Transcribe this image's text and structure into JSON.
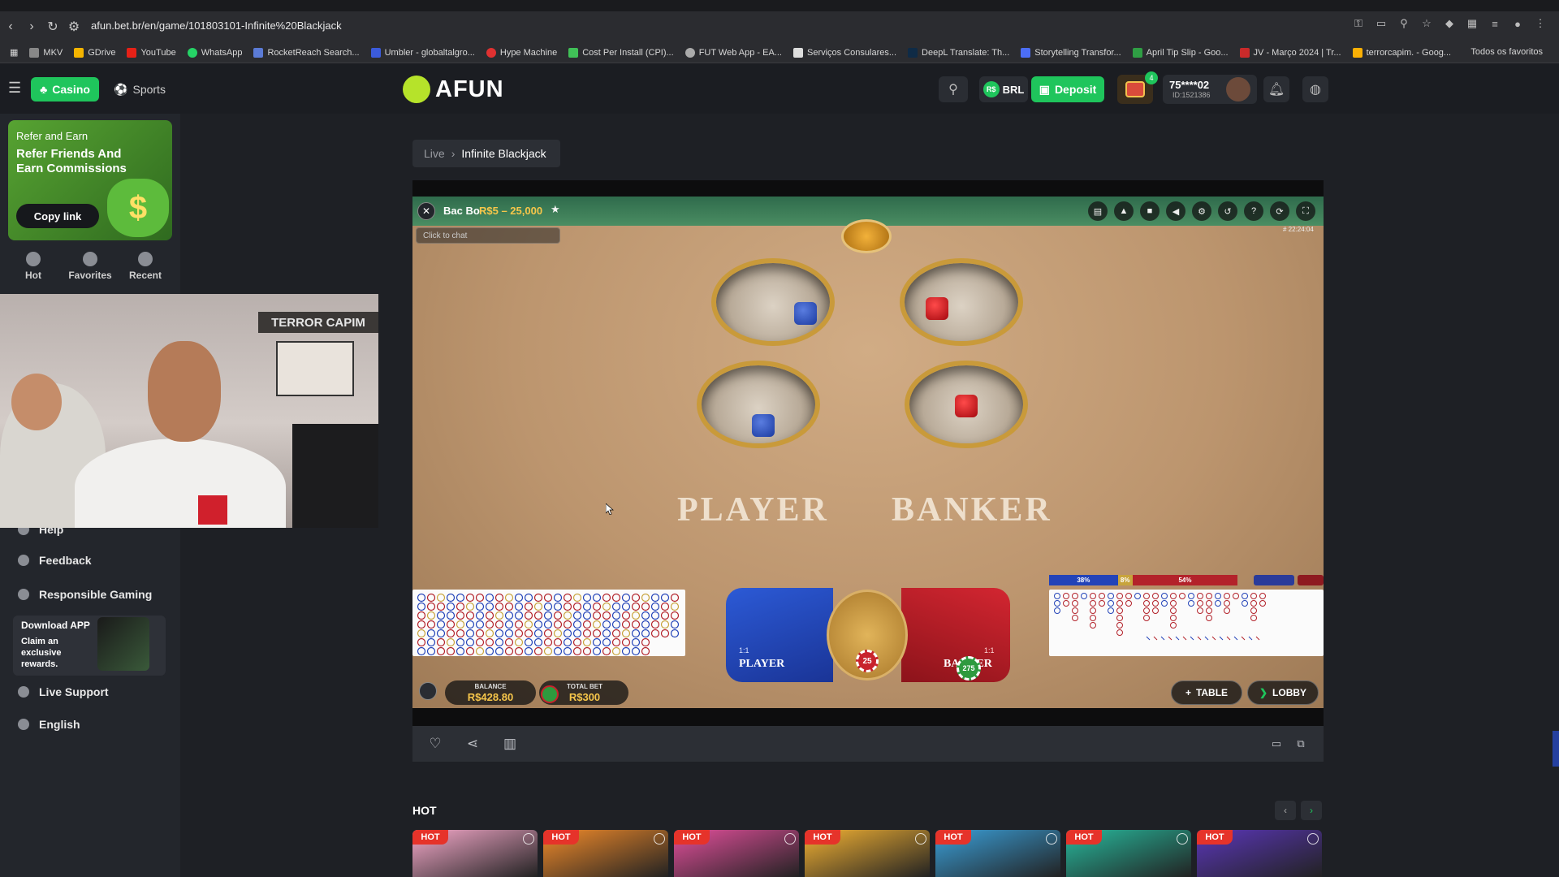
{
  "browser": {
    "url": "afun.bet.br/en/game/101803101-Infinite%20Blackjack",
    "bookmarks": [
      "MKV",
      "GDrive",
      "YouTube",
      "WhatsApp",
      "RocketReach Search...",
      "Umbler - globaltalgro...",
      "Hype Machine",
      "Cost Per Install (CPI)...",
      "FUT Web App - EA...",
      "Serviços Consulares...",
      "DeepL Translate: Th...",
      "Storytelling Transfor...",
      "April Tip Slip - Goo...",
      "JV - Março 2024 | Tr...",
      "terrorcapim. - Goog..."
    ],
    "bookmarks_folder": "Todos os favoritos"
  },
  "header": {
    "casino_label": "Casino",
    "sports_label": "Sports",
    "logo_text": "AFUN",
    "currency": "BRL",
    "currency_symbol": "R$",
    "deposit_label": "Deposit",
    "gift_count": "4",
    "username": "75****02",
    "user_id": "ID:1521386"
  },
  "sidebar": {
    "refer_title": "Refer and Earn",
    "refer_headline": "Refer Friends And Earn Commissions",
    "copy_link_label": "Copy link",
    "tabs": [
      {
        "label": "Hot"
      },
      {
        "label": "Favorites"
      },
      {
        "label": "Recent"
      }
    ],
    "links": [
      {
        "label": "Help"
      },
      {
        "label": "Feedback"
      },
      {
        "label": "Responsible Gaming"
      },
      {
        "label": "Live Support"
      },
      {
        "label": "English"
      }
    ],
    "download_title": "Download APP",
    "download_text": "Claim an exclusive rewards.",
    "webcam_overlay": "TERROR CAPIM"
  },
  "breadcrumb": {
    "live": "Live",
    "game": "Infinite Blackjack"
  },
  "game": {
    "title": "Bac Bo",
    "limits": "R$5 – 25,000",
    "chat_placeholder": "Click to chat",
    "time": "# 22:24:04",
    "player_word": "PLAYER",
    "banker_word": "BANKER",
    "player_label": "PLAYER",
    "banker_label": "BANKER",
    "player_odds": "1:1",
    "banker_odds": "1:1",
    "tie_chip": "25",
    "banker_chip": "275",
    "stats": {
      "player_pct": "38%",
      "tie_pct": "8%",
      "banker_pct": "54%"
    },
    "balance_label": "BALANCE",
    "balance_value": "R$428.80",
    "total_bet_label": "TOTAL BET",
    "total_bet_value": "R$300",
    "table_btn": "TABLE",
    "lobby_btn": "LOBBY",
    "dice": {
      "player": [
        "blue",
        "blue"
      ],
      "banker": [
        "red",
        "red"
      ]
    }
  },
  "hot": {
    "title": "HOT",
    "badge": "HOT",
    "cards": [
      {
        "color": "#f4a8c9"
      },
      {
        "color": "#f08a2a"
      },
      {
        "color": "#e24f9b"
      },
      {
        "color": "#f2b133"
      },
      {
        "color": "#3a9fd8"
      },
      {
        "color": "#27b89c"
      },
      {
        "color": "#5a36b8"
      }
    ]
  },
  "colors": {
    "accent": "#1fc55c",
    "gold": "#f7c64a",
    "player_blue": "#2343b8",
    "banker_red": "#b3222a"
  }
}
